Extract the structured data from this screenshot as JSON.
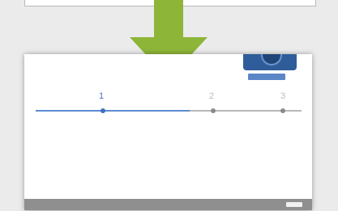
{
  "top_strip": {
    "text": ""
  },
  "arrow": {
    "color": "#8db538",
    "icon": "down-arrow-icon"
  },
  "doc": {
    "intro_lines": [
      "",
      ""
    ],
    "docs_button_label": "",
    "steps": [
      {
        "title": "",
        "subtitle": "",
        "number": "1"
      },
      {
        "title": "",
        "subtitle": "",
        "number": "2"
      },
      {
        "title": "",
        "subtitle": "",
        "number": "3"
      }
    ],
    "columns": [
      [
        "",
        "",
        "",
        "",
        ""
      ],
      [
        "",
        "",
        "",
        "",
        "",
        "",
        "",
        "",
        "",
        "",
        "",
        "",
        "",
        "",
        ""
      ],
      [
        "",
        "",
        "",
        "",
        ""
      ]
    ],
    "footer_text": ""
  },
  "colors": {
    "accent_blue": "#4a6fb5",
    "arrow_green": "#8db538",
    "footer_gray": "#8f8f8f"
  }
}
